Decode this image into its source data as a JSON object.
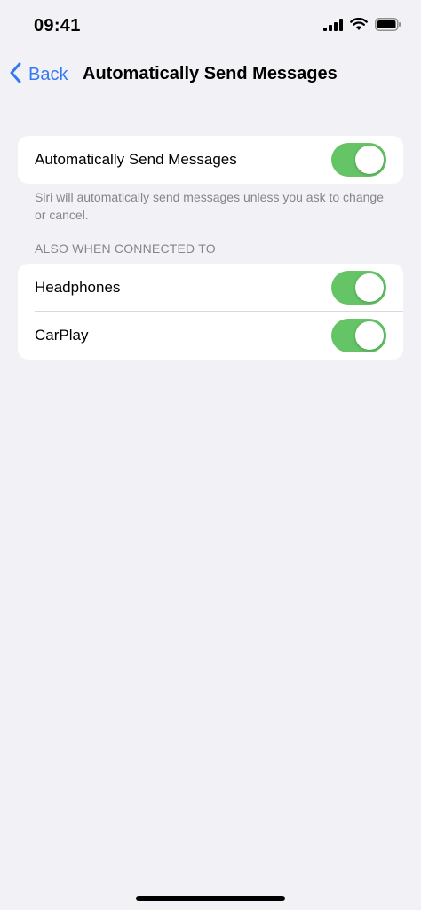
{
  "status_bar": {
    "time": "09:41",
    "icons": [
      "signal-icon",
      "wifi-icon",
      "battery-icon"
    ]
  },
  "nav": {
    "back_label": "Back",
    "title": "Automatically Send Messages"
  },
  "main_setting": {
    "label": "Automatically Send Messages",
    "enabled": true,
    "footer": "Siri will automatically send messages unless you ask to change or cancel."
  },
  "connected_section": {
    "header": "ALSO WHEN CONNECTED TO",
    "items": [
      {
        "label": "Headphones",
        "enabled": true
      },
      {
        "label": "CarPlay",
        "enabled": true
      }
    ]
  },
  "colors": {
    "accent": "#3478f6",
    "toggle_on": "#65c466",
    "background": "#f2f1f6",
    "secondary_text": "#85858a"
  }
}
